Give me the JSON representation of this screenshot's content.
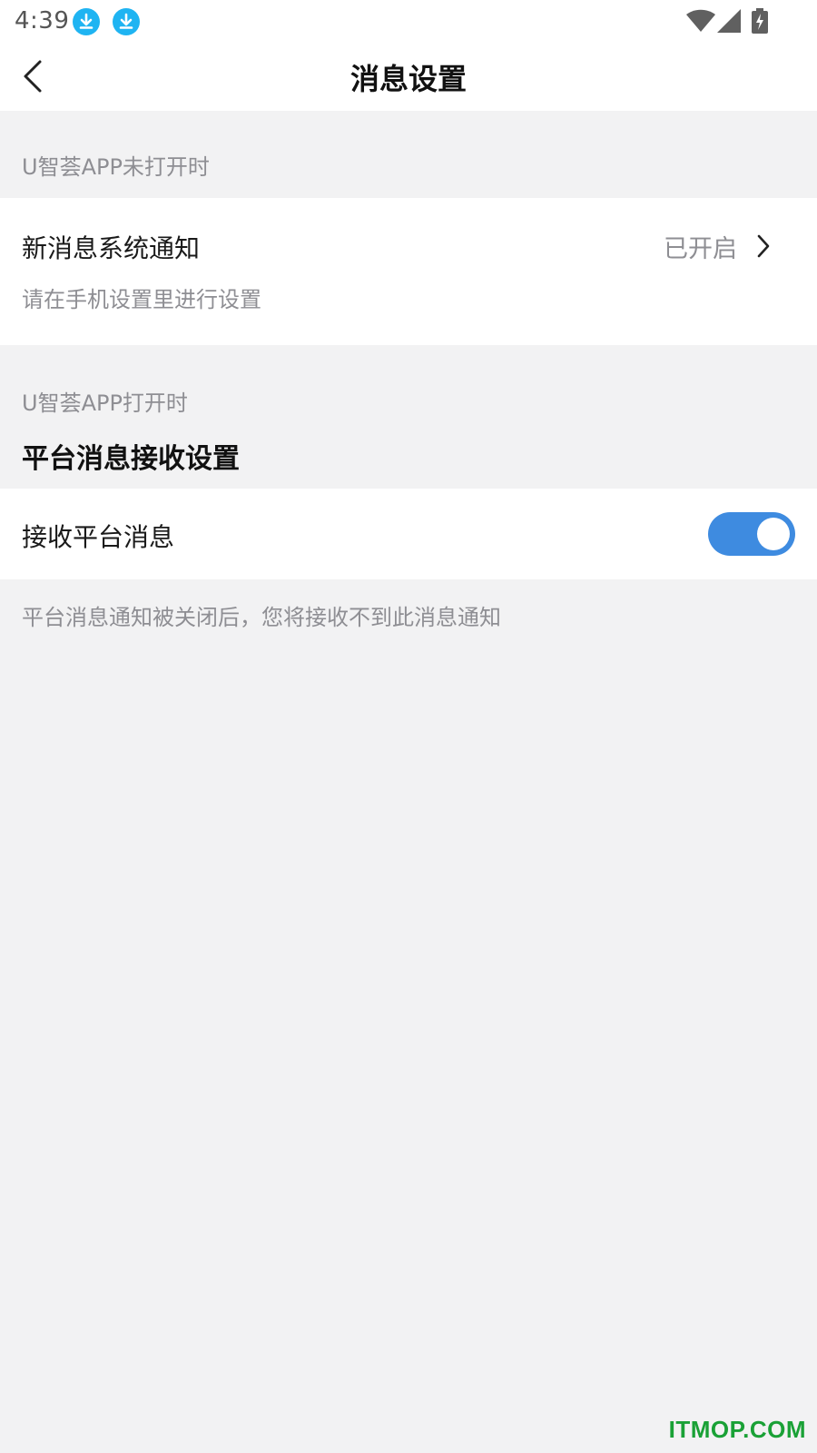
{
  "status_bar": {
    "time": "4:39",
    "notification_icons": [
      "download-icon",
      "download-icon"
    ],
    "system_icons": [
      "wifi-icon",
      "signal-icon",
      "battery-charging-icon"
    ]
  },
  "nav": {
    "title": "消息设置",
    "back_icon": "back-arrow-icon"
  },
  "section_closed": {
    "caption": "U智荟APP未打开时",
    "row": {
      "title": "新消息系统通知",
      "subtitle": "请在手机设置里进行设置",
      "status": "已开启",
      "chevron_icon": "chevron-right-icon"
    }
  },
  "section_open": {
    "caption": "U智荟APP打开时",
    "heading": "平台消息接收设置",
    "row": {
      "title": "接收平台消息",
      "toggle_on": true
    },
    "footnote": "平台消息通知被关闭后，您将接收不到此消息通知"
  },
  "watermark": "ITMOP.COM",
  "colors": {
    "accent": "#3e8be0",
    "background": "#f2f2f3",
    "secondary_text": "#8e8e93",
    "watermark": "#1aa136"
  }
}
